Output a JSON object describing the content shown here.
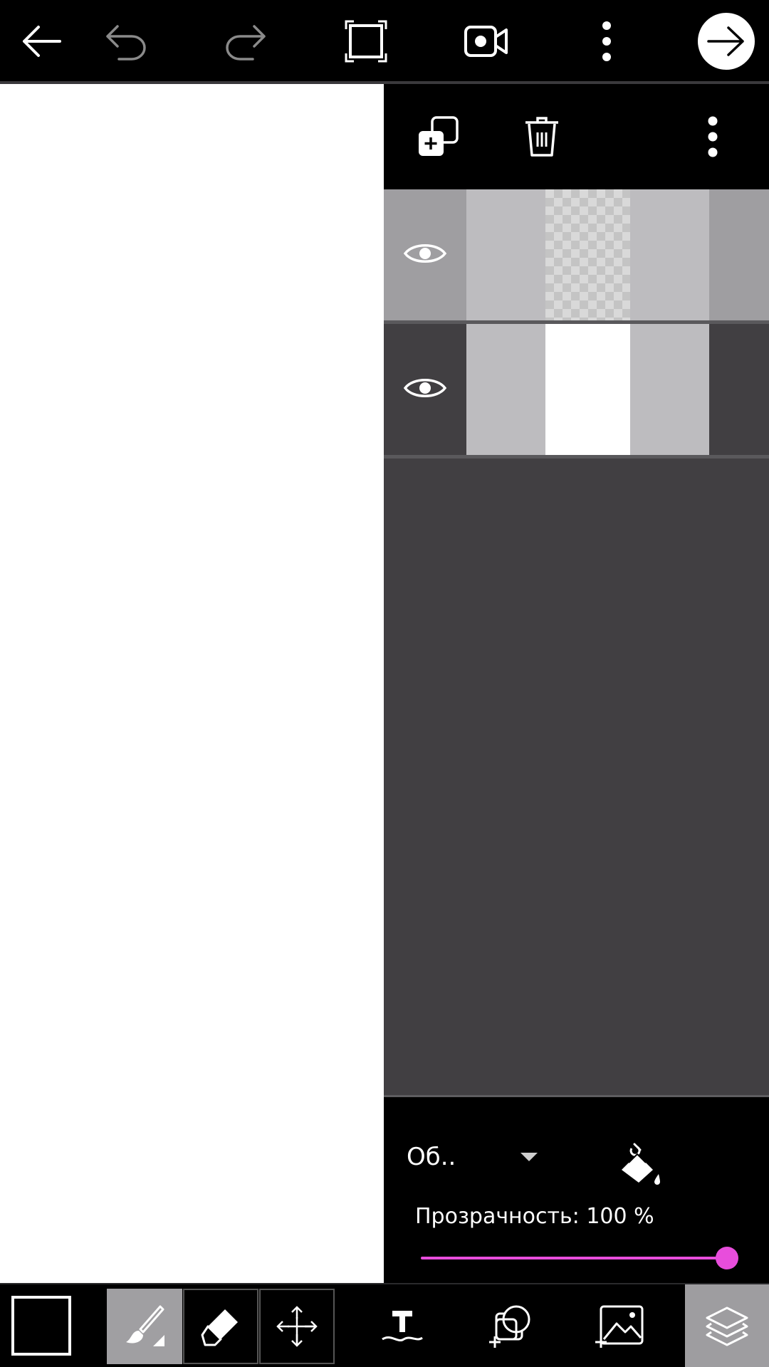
{
  "topbar": {
    "icons": [
      "back-arrow-icon",
      "undo-icon",
      "redo-icon",
      "fullscreen-frame-icon",
      "video-record-icon",
      "more-vertical-icon",
      "forward-arrow-icon"
    ]
  },
  "layers_panel": {
    "icons": [
      "duplicate-layer-icon",
      "trash-icon",
      "more-vertical-icon"
    ],
    "layers": [
      {
        "visible": true,
        "thumbnail": "transparent",
        "selected": true
      },
      {
        "visible": true,
        "thumbnail": "white",
        "selected": false
      }
    ],
    "blend_mode": "Об..",
    "opacity_text": "Прозрачность: 100 %",
    "opacity_value": 100,
    "accent": "#e84ddc"
  },
  "bottombar": {
    "current_color": "#000000",
    "tools": [
      "brush-icon",
      "eraser-icon",
      "move-icon",
      "text-icon",
      "add-sticker-icon",
      "add-photo-icon",
      "layers-icon"
    ],
    "active_tool": "brush-icon"
  }
}
